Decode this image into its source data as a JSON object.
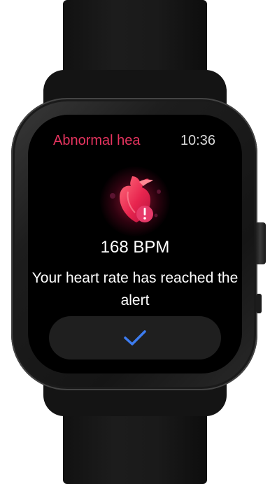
{
  "screen": {
    "title": "Abnormal hea",
    "time": "10:36",
    "bpm": "168 BPM",
    "message": "Your heart rate has reached the alert",
    "confirm_icon": "checkmark-icon",
    "alert_icon": "heart-alert-icon"
  },
  "colors": {
    "title": "#e6345f",
    "accent_check": "#3d7cf0",
    "background": "#000000"
  }
}
